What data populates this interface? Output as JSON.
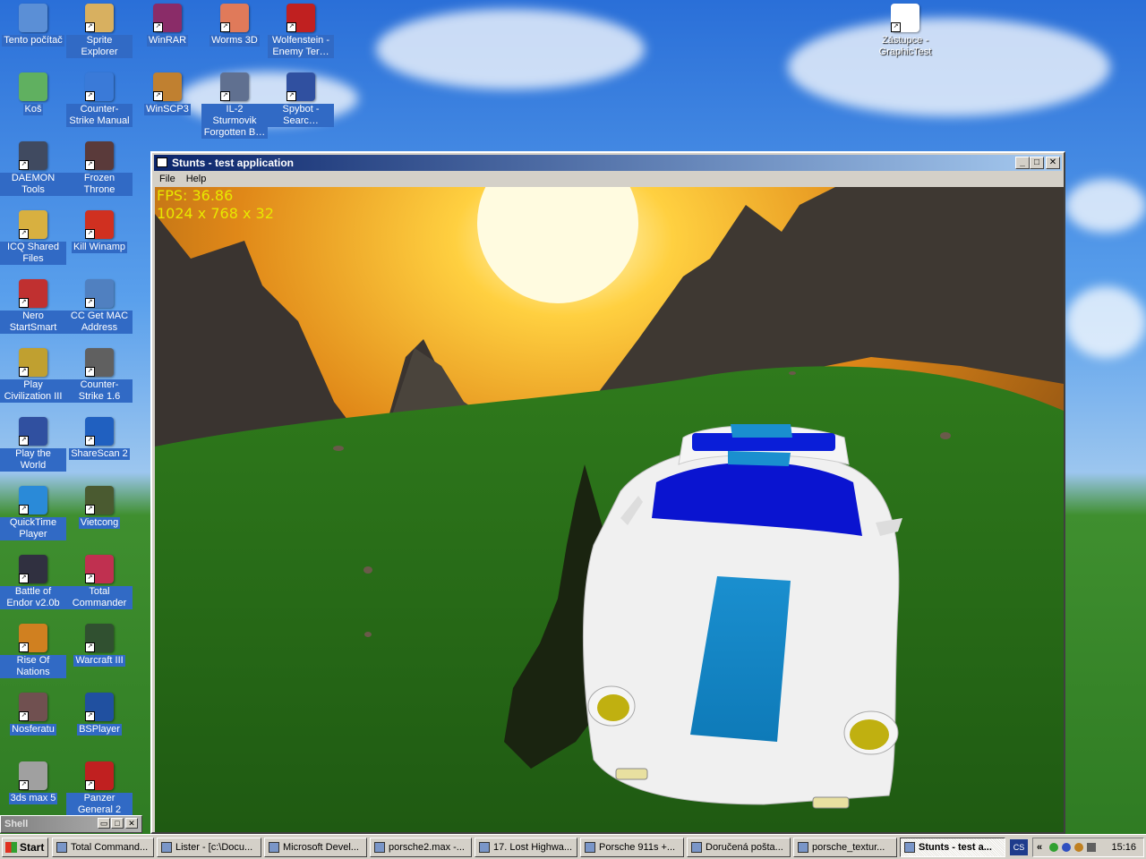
{
  "desktop": {
    "icons": [
      {
        "id": "tento-pocitac",
        "label": "Tento počítač",
        "icon": "computer-icon",
        "color": "#5b8fd6"
      },
      {
        "id": "sprite-explorer",
        "label": "Sprite Explorer",
        "icon": "sprite-explorer-icon",
        "color": "#d8b060"
      },
      {
        "id": "winrar",
        "label": "WinRAR",
        "icon": "winrar-icon",
        "color": "#8a2c68"
      },
      {
        "id": "worms-3d",
        "label": "Worms 3D",
        "icon": "worms-icon",
        "color": "#e07a5a"
      },
      {
        "id": "wolfenstein",
        "label": "Wolfenstein - Enemy Ter…",
        "icon": "wolfenstein-icon",
        "color": "#c02020"
      },
      {
        "id": "kos",
        "label": "Koš",
        "icon": "recycle-bin-icon",
        "color": "#60b060"
      },
      {
        "id": "cs-manual",
        "label": "Counter-Strike Manual",
        "icon": "document-icon",
        "color": "#3a7ad8"
      },
      {
        "id": "winscp3",
        "label": "WinSCP3",
        "icon": "winscp-icon",
        "color": "#c08030"
      },
      {
        "id": "il2",
        "label": "IL-2 Sturmovik Forgotten B…",
        "icon": "plane-icon",
        "color": "#607090"
      },
      {
        "id": "spybot",
        "label": "Spybot - Searc…",
        "icon": "spybot-icon",
        "color": "#3050a0"
      },
      {
        "id": "daemon",
        "label": "DAEMON Tools",
        "icon": "daemon-icon",
        "color": "#404a60"
      },
      {
        "id": "frozen-throne",
        "label": "Frozen Throne",
        "icon": "frozen-throne-icon",
        "color": "#5a3a3a"
      },
      {
        "id": "icq",
        "label": "ICQ Shared Files",
        "icon": "icq-icon",
        "color": "#d8b040"
      },
      {
        "id": "kill-winamp",
        "label": "Kill Winamp",
        "icon": "lightning-icon",
        "color": "#d03020"
      },
      {
        "id": "nero",
        "label": "Nero StartSmart",
        "icon": "nero-icon",
        "color": "#c03030"
      },
      {
        "id": "cc-mac",
        "label": "CC Get MAC Address",
        "icon": "network-icon",
        "color": "#5080c0"
      },
      {
        "id": "civ3",
        "label": "Play Civilization III",
        "icon": "civ-icon",
        "color": "#c0a030"
      },
      {
        "id": "cs16",
        "label": "Counter-Strike 1.6",
        "icon": "cs-icon",
        "color": "#606060"
      },
      {
        "id": "civ3-ptw",
        "label": "Play the World",
        "icon": "civ-ptw-icon",
        "color": "#3050a0"
      },
      {
        "id": "sharescan",
        "label": "ShareScan 2",
        "icon": "sharescan-icon",
        "color": "#2060c0"
      },
      {
        "id": "quicktime",
        "label": "QuickTime Player",
        "icon": "quicktime-icon",
        "color": "#2a8ad8"
      },
      {
        "id": "vietcong",
        "label": "Vietcong",
        "icon": "vietcong-icon",
        "color": "#4a5a30"
      },
      {
        "id": "battle-endor",
        "label": "Battle of Endor v2.0b",
        "icon": "endor-icon",
        "color": "#303040"
      },
      {
        "id": "total-commander",
        "label": "Total Commander",
        "icon": "floppy-icon",
        "color": "#c03050"
      },
      {
        "id": "rise-nations",
        "label": "Rise Of Nations",
        "icon": "rise-nations-icon",
        "color": "#d08020"
      },
      {
        "id": "warcraft3",
        "label": "Warcraft III",
        "icon": "warcraft-icon",
        "color": "#305030"
      },
      {
        "id": "nosferatu",
        "label": "Nosferatu",
        "icon": "nosferatu-icon",
        "color": "#705050"
      },
      {
        "id": "bsplayer",
        "label": "BSPlayer",
        "icon": "bsplayer-icon",
        "color": "#2050a0"
      },
      {
        "id": "3dsmax",
        "label": "3ds max 5",
        "icon": "3dsmax-icon",
        "color": "#a0a0a0"
      },
      {
        "id": "panzer",
        "label": "Panzer General 2",
        "icon": "panzer-icon",
        "color": "#c02020"
      },
      {
        "id": "zastupce",
        "label": "Zástupce - GraphicTest",
        "icon": "window-shortcut-icon",
        "color": "#ffffff"
      }
    ]
  },
  "shell": {
    "title": "Shell"
  },
  "window": {
    "title": "Stunts - test application",
    "menu": [
      "File",
      "Help"
    ],
    "hud": {
      "fps": "FPS: 36.86",
      "resolution": "1024 x 768 x 32"
    }
  },
  "taskbar": {
    "start": "Start",
    "tasks": [
      {
        "label": "Total Command...",
        "active": false
      },
      {
        "label": "Lister - [c:\\Docu...",
        "active": false
      },
      {
        "label": "Microsoft Devel...",
        "active": false
      },
      {
        "label": "porsche2.max -...",
        "active": false
      },
      {
        "label": "17. Lost Highwa...",
        "active": false
      },
      {
        "label": "Porsche 911s +...",
        "active": false
      },
      {
        "label": "Doručená pošta...",
        "active": false
      },
      {
        "label": "porsche_textur...",
        "active": false
      },
      {
        "label": "Stunts - test a...",
        "active": true
      }
    ],
    "lang": "CS",
    "clock": "15:16"
  }
}
